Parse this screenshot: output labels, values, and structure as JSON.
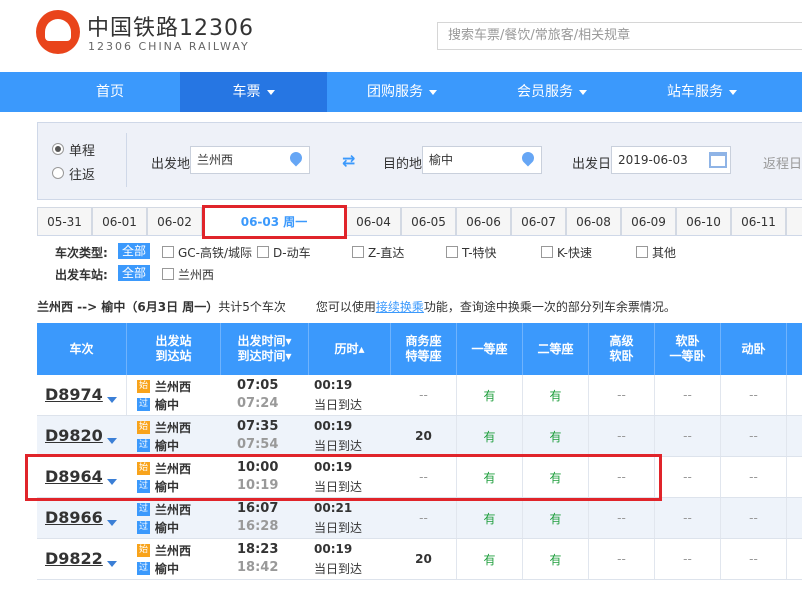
{
  "brand": {
    "title": "中国铁路12306",
    "subtitle": "12306 CHINA RAILWAY"
  },
  "search": {
    "placeholder": "搜索车票/餐饮/常旅客/相关规章"
  },
  "nav": [
    "首页",
    "车票",
    "团购服务",
    "会员服务",
    "站车服务"
  ],
  "query": {
    "trip_one_way": "单程",
    "trip_round": "往返",
    "from_label": "出发地",
    "from_value": "兰州西",
    "to_label": "目的地",
    "to_value": "榆中",
    "date_label": "出发日",
    "date_value": "2019-06-03",
    "return_label": "返程日"
  },
  "date_tabs": [
    "05-31",
    "06-01",
    "06-02",
    "06-03 周一",
    "06-04",
    "06-05",
    "06-06",
    "06-07",
    "06-08",
    "06-09",
    "06-10",
    "06-11"
  ],
  "filters": {
    "type_label": "车次类型:",
    "all": "全部",
    "types": [
      "GC-高铁/城际",
      "D-动车",
      "Z-直达",
      "T-特快",
      "K-快速",
      "其他"
    ],
    "station_label": "出发车站:",
    "stations": [
      "兰州西"
    ]
  },
  "summary": {
    "route": "兰州西 --> 榆中（6月3日 周一）",
    "count": "共计5个车次",
    "note_pre": "您可以使用",
    "note_link": "接续换乘",
    "note_post": "功能，查询途中换乘一次的部分列车余票情况。"
  },
  "headers": {
    "train": "车次",
    "station": [
      "出发站",
      "到达站"
    ],
    "time": [
      "出发时间▾",
      "到达时间▾"
    ],
    "duration": "历时▴",
    "business": [
      "商务座",
      "特等座"
    ],
    "first": "一等座",
    "second": "二等座",
    "adv_soft": [
      "高级",
      "软卧"
    ],
    "soft": [
      "软卧",
      "一等卧"
    ],
    "moving": "动卧"
  },
  "rows": [
    {
      "train": "D8974",
      "start_tag": "始",
      "from": "兰州西",
      "pass_tag": "过",
      "to": "榆中",
      "dep": "07:05",
      "arr": "07:24",
      "duration": "00:19",
      "arrive_day": "当日到达",
      "business": "--",
      "first": "有",
      "second": "有",
      "adv_soft": "--",
      "soft": "--",
      "moving": "--"
    },
    {
      "train": "D9820",
      "start_tag": "始",
      "from": "兰州西",
      "pass_tag": "过",
      "to": "榆中",
      "dep": "07:35",
      "arr": "07:54",
      "duration": "00:19",
      "arrive_day": "当日到达",
      "business": "20",
      "first": "有",
      "second": "有",
      "adv_soft": "--",
      "soft": "--",
      "moving": "--"
    },
    {
      "train": "D8964",
      "start_tag": "始",
      "from": "兰州西",
      "pass_tag": "过",
      "to": "榆中",
      "dep": "10:00",
      "arr": "10:19",
      "duration": "00:19",
      "arrive_day": "当日到达",
      "business": "--",
      "first": "有",
      "second": "有",
      "adv_soft": "--",
      "soft": "--",
      "moving": "--"
    },
    {
      "train": "D8966",
      "start_tag": "过",
      "from": "兰州西",
      "pass_tag": "过",
      "to": "榆中",
      "dep": "16:07",
      "arr": "16:28",
      "duration": "00:21",
      "arrive_day": "当日到达",
      "business": "--",
      "first": "有",
      "second": "有",
      "adv_soft": "--",
      "soft": "--",
      "moving": "--"
    },
    {
      "train": "D9822",
      "start_tag": "始",
      "from": "兰州西",
      "pass_tag": "过",
      "to": "榆中",
      "dep": "18:23",
      "arr": "18:42",
      "duration": "00:19",
      "arrive_day": "当日到达",
      "business": "20",
      "first": "有",
      "second": "有",
      "adv_soft": "--",
      "soft": "--",
      "moving": "--"
    }
  ],
  "colors": {
    "accent": "#3b99fc",
    "highlight": "#e0242a",
    "available": "#1e9e3c"
  }
}
